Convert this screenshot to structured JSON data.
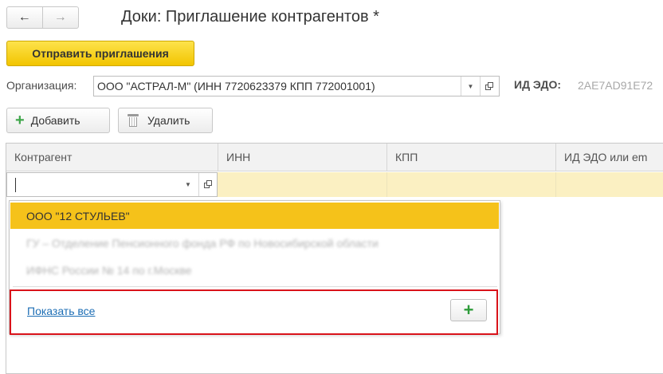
{
  "nav": {
    "back_icon": "arrow-left-icon",
    "forward_icon": "arrow-right-icon"
  },
  "title": "Доки: Приглашение контрагентов *",
  "toolbar": {
    "send_label": "Отправить приглашения"
  },
  "organization": {
    "label": "Организация:",
    "value": "ООО \"АСТРАЛ-М\" (ИНН 7720623379 КПП 772001001)"
  },
  "edo": {
    "label": "ИД ЭДО:",
    "value": "2AE7AD91E72"
  },
  "table_toolbar": {
    "add_label": "Добавить",
    "delete_label": "Удалить"
  },
  "table": {
    "columns": [
      "Контрагент",
      "ИНН",
      "КПП",
      "ИД ЭДО или em"
    ]
  },
  "dropdown": {
    "items": [
      "ООО \"12 СТУЛЬЕВ\"",
      "ГУ – Отделение Пенсионного фонда РФ по Новосибирской области",
      "ИФНС России № 14 по г.Москве"
    ],
    "show_all": "Показать все",
    "create_icon": "plus-icon"
  },
  "colors": {
    "accent_yellow": "#f5c21a",
    "highlight_red": "#d9131a",
    "link_blue": "#1d6eb5",
    "plus_green": "#3fa64a",
    "row_edit": "#fbf0c2"
  }
}
